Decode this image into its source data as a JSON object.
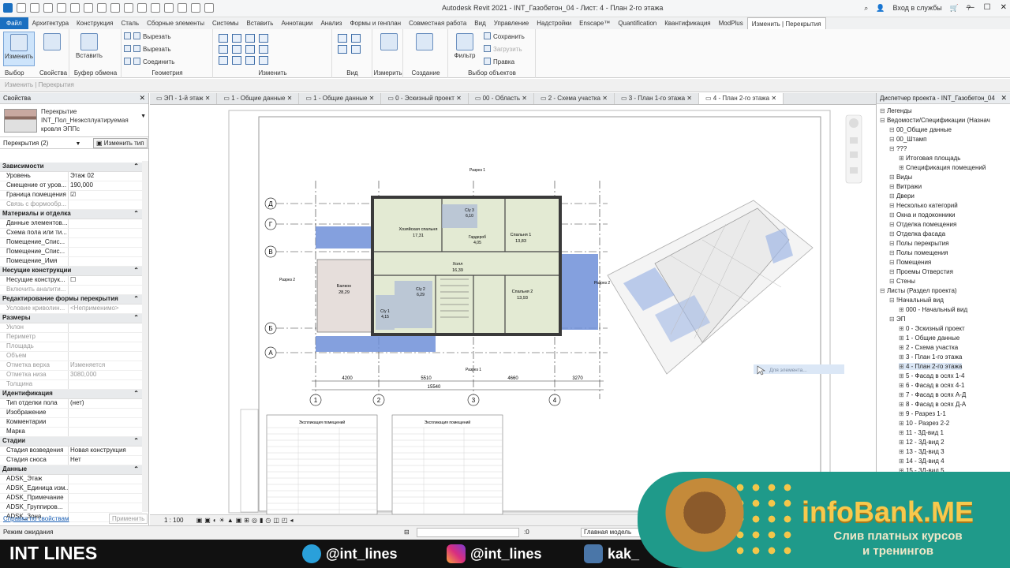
{
  "window": {
    "title": "Autodesk Revit 2021 - INT_Газобетон_04 - Лист: 4 - План 2-го этажа",
    "login": "Вход в службы"
  },
  "menu": [
    "Файл",
    "Архитектура",
    "Конструкция",
    "Сталь",
    "Сборные элементы",
    "Системы",
    "Вставить",
    "Аннотации",
    "Анализ",
    "Формы и генплан",
    "Совместная работа",
    "Вид",
    "Управление",
    "Надстройки",
    "Enscape™",
    "Quantification",
    "Квантификация",
    "ModPlus",
    "Изменить | Перекрытия"
  ],
  "ribbon": {
    "modify": "Изменить",
    "select": "Выбор",
    "properties": "Свойства",
    "paste": "Вставить",
    "clipboard": "Буфер обмена",
    "cut": "Вырезать",
    "cut2": "Вырезать",
    "join": "Соединить",
    "geometry": "Геометрия",
    "modify_group": "Изменить",
    "view": "Вид",
    "measure": "Измерить",
    "create": "Создание",
    "save": "Сохранить",
    "load": "Загрузить",
    "edit_sel": "Правка",
    "filter": "Фильтр",
    "select_sets": "Выбор объектов"
  },
  "optbar": "Изменить | Перекрытия",
  "props": {
    "header": "Свойства",
    "type_name": [
      "Перекрытие",
      "INT_Пол_Неэксплуатируемая",
      "кровля ЭППс"
    ],
    "instance": "Перекрытия (2)",
    "edit_type": "Изменить тип",
    "sections": [
      {
        "title": "Зависимости",
        "rows": [
          [
            "Уровень",
            "Этаж 02"
          ],
          [
            "Смещение от уров...",
            "190,000"
          ],
          [
            "Граница помещения",
            "☑"
          ],
          [
            "Связь с формообр...",
            ""
          ]
        ]
      },
      {
        "title": "Материалы и отделка",
        "rows": [
          [
            "Данные элементов...",
            ""
          ],
          [
            "Схема пола или ти...",
            ""
          ],
          [
            "Помещение_Спис...",
            ""
          ],
          [
            "Помещение_Спис...",
            ""
          ],
          [
            "Помещение_Имя",
            ""
          ]
        ]
      },
      {
        "title": "Несущие конструкции",
        "rows": [
          [
            "Несущие конструк...",
            "☐"
          ],
          [
            "Включить аналити...",
            ""
          ]
        ]
      },
      {
        "title": "Редактирование формы перекрытия",
        "rows": [
          [
            "Условие криволин...",
            "<Неприменимо>"
          ]
        ]
      },
      {
        "title": "Размеры",
        "rows": [
          [
            "Уклон",
            ""
          ],
          [
            "Периметр",
            ""
          ],
          [
            "Площадь",
            ""
          ],
          [
            "Объем",
            ""
          ],
          [
            "Отметка верха",
            "Изменяется"
          ],
          [
            "Отметка низа",
            "3080,000"
          ],
          [
            "Толщина",
            ""
          ]
        ]
      },
      {
        "title": "Идентификация",
        "rows": [
          [
            "Тип отделки пола",
            "(нет)"
          ],
          [
            "Изображение",
            ""
          ],
          [
            "Комментарии",
            ""
          ],
          [
            "Марка",
            ""
          ]
        ]
      },
      {
        "title": "Стадии",
        "rows": [
          [
            "Стадия возведения",
            "Новая конструкция"
          ],
          [
            "Стадия сноса",
            "Нет"
          ]
        ]
      },
      {
        "title": "Данные",
        "rows": [
          [
            "ADSK_Этаж",
            ""
          ],
          [
            "ADSK_Единица изм...",
            ""
          ],
          [
            "ADSK_Примечание",
            ""
          ],
          [
            "ADSK_Группиров...",
            ""
          ],
          [
            "ADSK_Зона",
            ""
          ]
        ]
      }
    ],
    "help": "Справка по свойствам",
    "apply": "Применить"
  },
  "tabs": [
    "ЭП - 1-й этаж",
    "1 - Общие данные",
    "1 - Общие данные",
    "0 - Эскизный проект",
    "00 - Область",
    "2 - Схема участка",
    "3 - План 1-го этажа",
    "4 - План 2-го этажа"
  ],
  "plan": {
    "rows": [
      "Д",
      "Г",
      "В",
      "Б",
      "А"
    ],
    "cols": [
      "1",
      "2",
      "3",
      "4"
    ],
    "rooms": [
      {
        "name": "Хозяйская спальня",
        "area": "17,31"
      },
      {
        "name": "С/у 3",
        "area": "6,10"
      },
      {
        "name": "Гардероб",
        "area": "4,05"
      },
      {
        "name": "Спальня 1",
        "area": "13,83"
      },
      {
        "name": "Холл",
        "area": "16,39"
      },
      {
        "name": "Балкон",
        "area": "28,29"
      },
      {
        "name": "С/у 2",
        "area": "6,29"
      },
      {
        "name": "Спальня 2",
        "area": "13,93"
      },
      {
        "name": "С/у 1",
        "area": "4,15"
      }
    ],
    "dims": {
      "d1": "4200",
      "d2": "5510",
      "d3": "4660",
      "d4": "3270",
      "total": "15540"
    },
    "section1": "Разрез 1",
    "section2": "Разрез 2",
    "tooltip": "Для элемента...",
    "table1_title": "Экспликация помещений",
    "table2_title": "Экспликация помещений"
  },
  "status": {
    "scale": "1 : 100",
    "ready": "Режим ожидания",
    "model": "Главная модель",
    "zero": ":0"
  },
  "browser": {
    "header": "Диспетчер проекта - INT_Газобетон_04",
    "items": [
      {
        "t": "Легенды",
        "l": 1
      },
      {
        "t": "Ведомости/Спецификации (Назнач",
        "l": 1
      },
      {
        "t": "00_Общие данные",
        "l": 2
      },
      {
        "t": "00_Штамп",
        "l": 2
      },
      {
        "t": "???",
        "l": 2
      },
      {
        "t": "Итоговая площадь",
        "l": 3
      },
      {
        "t": "Спецификация помещений",
        "l": 3
      },
      {
        "t": "Виды",
        "l": 2
      },
      {
        "t": "Витражи",
        "l": 2
      },
      {
        "t": "Двери",
        "l": 2
      },
      {
        "t": "Несколько категорий",
        "l": 2
      },
      {
        "t": "Окна и подоконники",
        "l": 2
      },
      {
        "t": "Отделка помещения",
        "l": 2
      },
      {
        "t": "Отделка фасада",
        "l": 2
      },
      {
        "t": "Полы перекрытия",
        "l": 2
      },
      {
        "t": "Полы помещения",
        "l": 2
      },
      {
        "t": "Помещения",
        "l": 2
      },
      {
        "t": "Проемы Отверстия",
        "l": 2
      },
      {
        "t": "Стены",
        "l": 2
      },
      {
        "t": "Листы (Раздел проекта)",
        "l": 1
      },
      {
        "t": "!Начальный вид",
        "l": 2
      },
      {
        "t": "000 - Начальный вид",
        "l": 3
      },
      {
        "t": "ЭП",
        "l": 2
      },
      {
        "t": "0 - Эскизный проект",
        "l": 3
      },
      {
        "t": "1 - Общие данные",
        "l": 3
      },
      {
        "t": "2 - Схема участка",
        "l": 3
      },
      {
        "t": "3 - План 1-го этажа",
        "l": 3
      },
      {
        "t": "4 - План 2-го этажа",
        "l": 3,
        "sel": true
      },
      {
        "t": "5 - Фасад в осях 1-4",
        "l": 3
      },
      {
        "t": "6 - Фасад в осях 4-1",
        "l": 3
      },
      {
        "t": "7 - Фасад в осях А-Д",
        "l": 3
      },
      {
        "t": "8 - Фасад в осях Д-А",
        "l": 3
      },
      {
        "t": "9 - Разрез 1-1",
        "l": 3
      },
      {
        "t": "10 - Разрез 2-2",
        "l": 3
      },
      {
        "t": "11 - 3Д-вид 1",
        "l": 3
      },
      {
        "t": "12 - 3Д-вид 2",
        "l": 3
      },
      {
        "t": "13 - 3Д-вид 3",
        "l": 3
      },
      {
        "t": "14 - 3Д-вид 4",
        "l": 3
      },
      {
        "t": "15 - 3Д-вид 5",
        "l": 3
      }
    ]
  },
  "overlay": {
    "brand": "INT LINES",
    "telegram": "@int_lines",
    "instagram": "@int_lines",
    "vk": "kak_",
    "promo_title": "infoBank.ME",
    "promo_sub1": "Слив платных курсов",
    "promo_sub2": "и тренингов"
  },
  "colors": {
    "accent": "#1a6fc0",
    "balcony": "#6f8fd8",
    "room": "#dfe8cf"
  }
}
